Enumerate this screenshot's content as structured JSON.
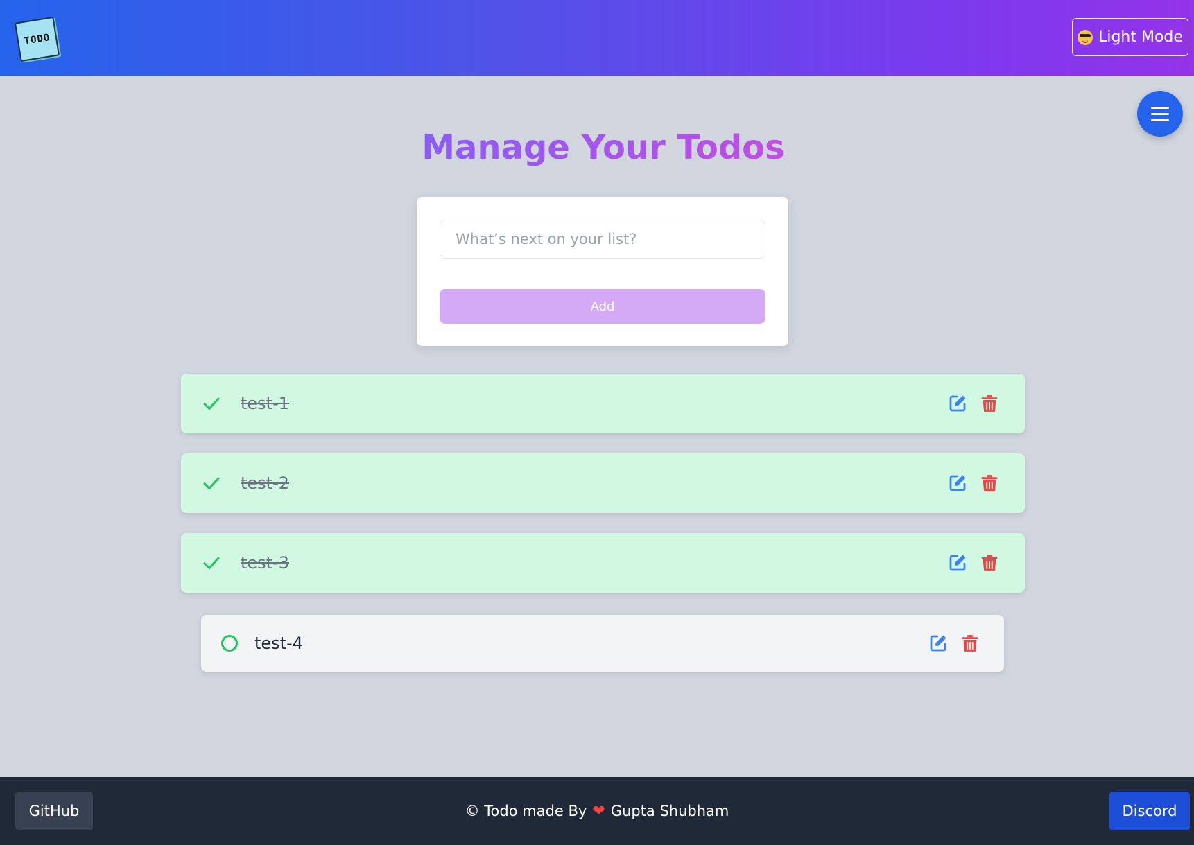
{
  "header": {
    "logo_text": "TODO",
    "mode_toggle_label": "Light Mode",
    "mode_toggle_icon": "sunglasses-emoji-icon"
  },
  "menu_button_icon": "hamburger-menu-icon",
  "page_title": "Manage Your Todos",
  "new_todo": {
    "value": "",
    "placeholder": "What’s next on your list?",
    "add_label": "Add"
  },
  "todos": [
    {
      "text": "test-1",
      "completed": true
    },
    {
      "text": "test-2",
      "completed": true
    },
    {
      "text": "test-3",
      "completed": true
    },
    {
      "text": "test-4",
      "completed": false
    }
  ],
  "footer": {
    "github_label": "GitHub",
    "credit_prefix": "© Todo made By",
    "credit_icon": "heart-icon",
    "credit_name": "Gupta Shubham",
    "discord_label": "Discord"
  },
  "colors": {
    "header_gradient_start": "#2563eb",
    "header_gradient_end": "#9333ea",
    "done_item_bg": "#d1f8e0",
    "check_green": "#22c55e",
    "edit_blue": "#3b82f6",
    "delete_red": "#ef4444",
    "add_button": "#d4aaf6",
    "footer_bg": "#1f2937",
    "discord_blue": "#1d4ed8"
  }
}
